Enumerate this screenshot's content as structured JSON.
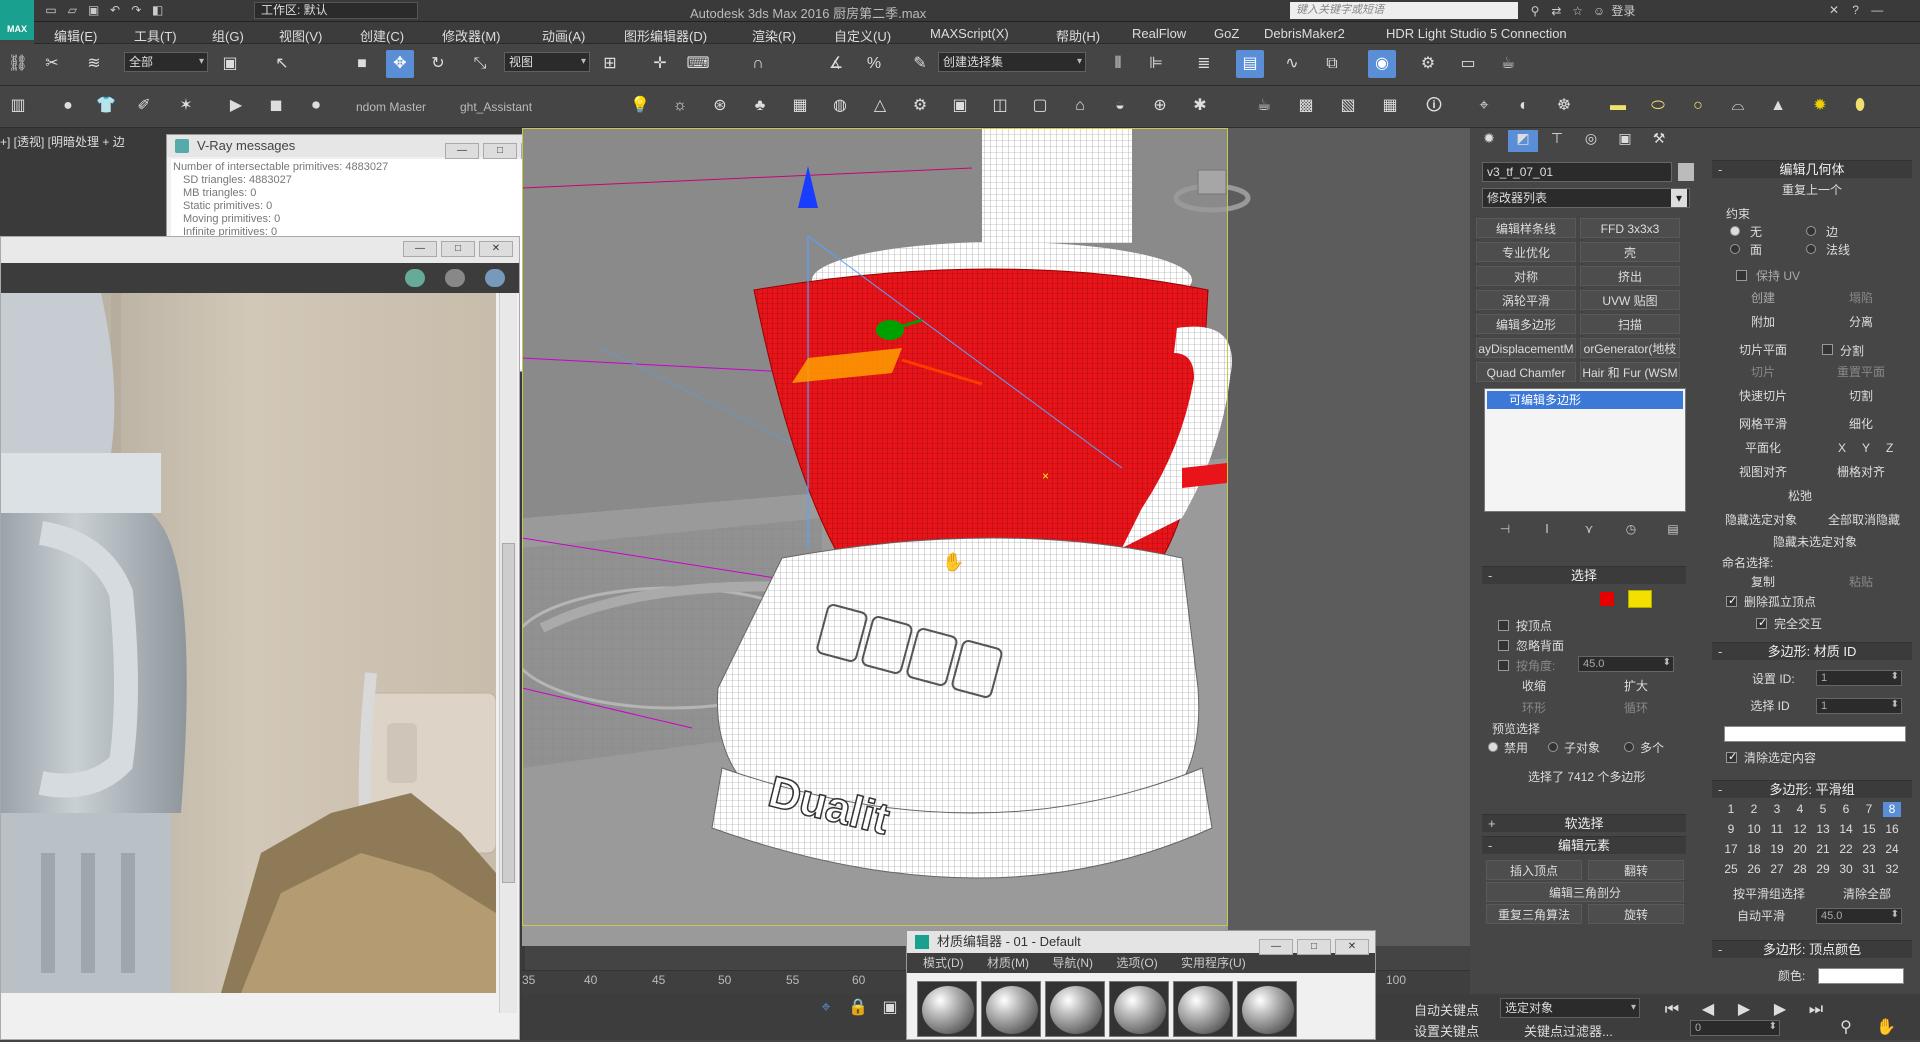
{
  "app": {
    "title": "Autodesk 3ds Max 2016    厨房第二季.max",
    "logo": "MAX",
    "workspace": "工作区: 默认",
    "search_placeholder": "键入关键字或短语",
    "login": "登录"
  },
  "menubar": [
    "编辑(E)",
    "工具(T)",
    "组(G)",
    "视图(V)",
    "创建(C)",
    "修改器(M)",
    "动画(A)",
    "图形编辑器(D)",
    "渲染(R)",
    "自定义(U)",
    "MAXScript(X)",
    "帮助(H)",
    "RealFlow",
    "GoZ",
    "DebrisMaker2",
    "HDR Light Studio 5 Connection"
  ],
  "toolbar1": {
    "filter": "全部",
    "view": "视图",
    "selection_set": "创建选择集"
  },
  "toolbar2": {
    "label1": "ndom Master",
    "label2": "ght_Assistant"
  },
  "viewport": {
    "label": "+] [透视] [明暗处理 + 边"
  },
  "vray": {
    "title": "V-Ray messages",
    "lines": [
      "Number of intersectable primitives: 4883027",
      "SD triangles: 4883027",
      "MB triangles: 0",
      "Static primitives: 0",
      "Moving primitives: 0",
      "Infinite primitives: 0"
    ]
  },
  "timeline": {
    "ticks": [
      "35",
      "40",
      "45",
      "50",
      "55",
      "60",
      "100"
    ]
  },
  "bottom": {
    "autokey": "自动关键点",
    "setkey": "设置关键点",
    "selected": "选定对象",
    "keyfilter": "关键点过滤器...",
    "frame": "0"
  },
  "material_editor": {
    "title": "材质编辑器 - 01 - Default",
    "menus": [
      "模式(D)",
      "材质(M)",
      "导航(N)",
      "选项(O)",
      "实用程序(U)"
    ],
    "slot_count": 6
  },
  "command_panel": {
    "object_name": "v3_tf_07_01",
    "modifier_list": "修改器列表",
    "modifier_buttons": [
      [
        "编辑样条线",
        "FFD 3x3x3"
      ],
      [
        "专业优化",
        "壳"
      ],
      [
        "对称",
        "挤出"
      ],
      [
        "涡轮平滑",
        "UVW 贴图"
      ],
      [
        "编辑多边形",
        "扫描"
      ],
      [
        "ayDisplacementM",
        "orGenerator(地枝"
      ],
      [
        "Quad Chamfer",
        "Hair 和 Fur (WSM"
      ]
    ],
    "stack_item": "可编辑多边形",
    "selection": {
      "header": "选择",
      "by_vertex": "按顶点",
      "ignore_back": "忽略背面",
      "by_angle": "按角度:",
      "angle_value": "45.0",
      "shrink": "收缩",
      "grow": "扩大",
      "ring": "环形",
      "loop": "循环",
      "preview": "预览选择",
      "disable": "禁用",
      "subobj": "子对象",
      "multi": "多个",
      "status": "选择了 7412 个多边形"
    },
    "soft_selection": "软选择",
    "edit_elements": {
      "header": "编辑元素",
      "insert_vertex": "插入顶点",
      "flip": "翻转",
      "edit_tri": "编辑三角剖分",
      "retri": "重复三角算法",
      "turn": "旋转"
    }
  },
  "edit_geometry": {
    "header": "编辑几何体",
    "repeat_last": "重复上一个",
    "constraints": "约束",
    "none": "无",
    "edge": "边",
    "face": "面",
    "normal": "法线",
    "preserve_uv": "保持 UV",
    "create": "创建",
    "collapse": "塌陷",
    "attach": "附加",
    "detach": "分离",
    "slice_plane": "切片平面",
    "split": "分割",
    "slice": "切片",
    "reset_plane": "重置平面",
    "quickslice": "快速切片",
    "cut": "切割",
    "meshsmooth": "网格平滑",
    "tessellate": "细化",
    "planar": "平面化",
    "x": "X",
    "y": "Y",
    "z": "Z",
    "view_align": "视图对齐",
    "grid_align": "栅格对齐",
    "relax": "松弛",
    "hide_sel": "隐藏选定对象",
    "unhide_all": "全部取消隐藏",
    "hide_unsel": "隐藏未选定对象",
    "named_sel": "命名选择:",
    "copy": "复制",
    "paste": "粘贴",
    "delete_iso": "删除孤立顶点",
    "full_interact": "完全交互"
  },
  "poly_matid": {
    "header": "多边形: 材质 ID",
    "set_id": "设置 ID:",
    "set_id_val": "1",
    "select_id": "选择 ID",
    "select_id_val": "1",
    "clear_sel": "清除选定内容"
  },
  "smoothing": {
    "header": "多边形: 平滑组",
    "groups": [
      "1",
      "2",
      "3",
      "4",
      "5",
      "6",
      "7",
      "8",
      "9",
      "10",
      "11",
      "12",
      "13",
      "14",
      "15",
      "16",
      "17",
      "18",
      "19",
      "20",
      "21",
      "22",
      "23",
      "24",
      "25",
      "26",
      "27",
      "28",
      "29",
      "30",
      "31",
      "32"
    ],
    "active": "8",
    "select_by": "按平滑组选择",
    "clear_all": "清除全部",
    "auto_smooth": "自动平滑",
    "auto_val": "45.0"
  },
  "vertex_color": {
    "header": "多边形: 顶点颜色",
    "color": "颜色:"
  },
  "model": {
    "brand": "Dualit"
  }
}
